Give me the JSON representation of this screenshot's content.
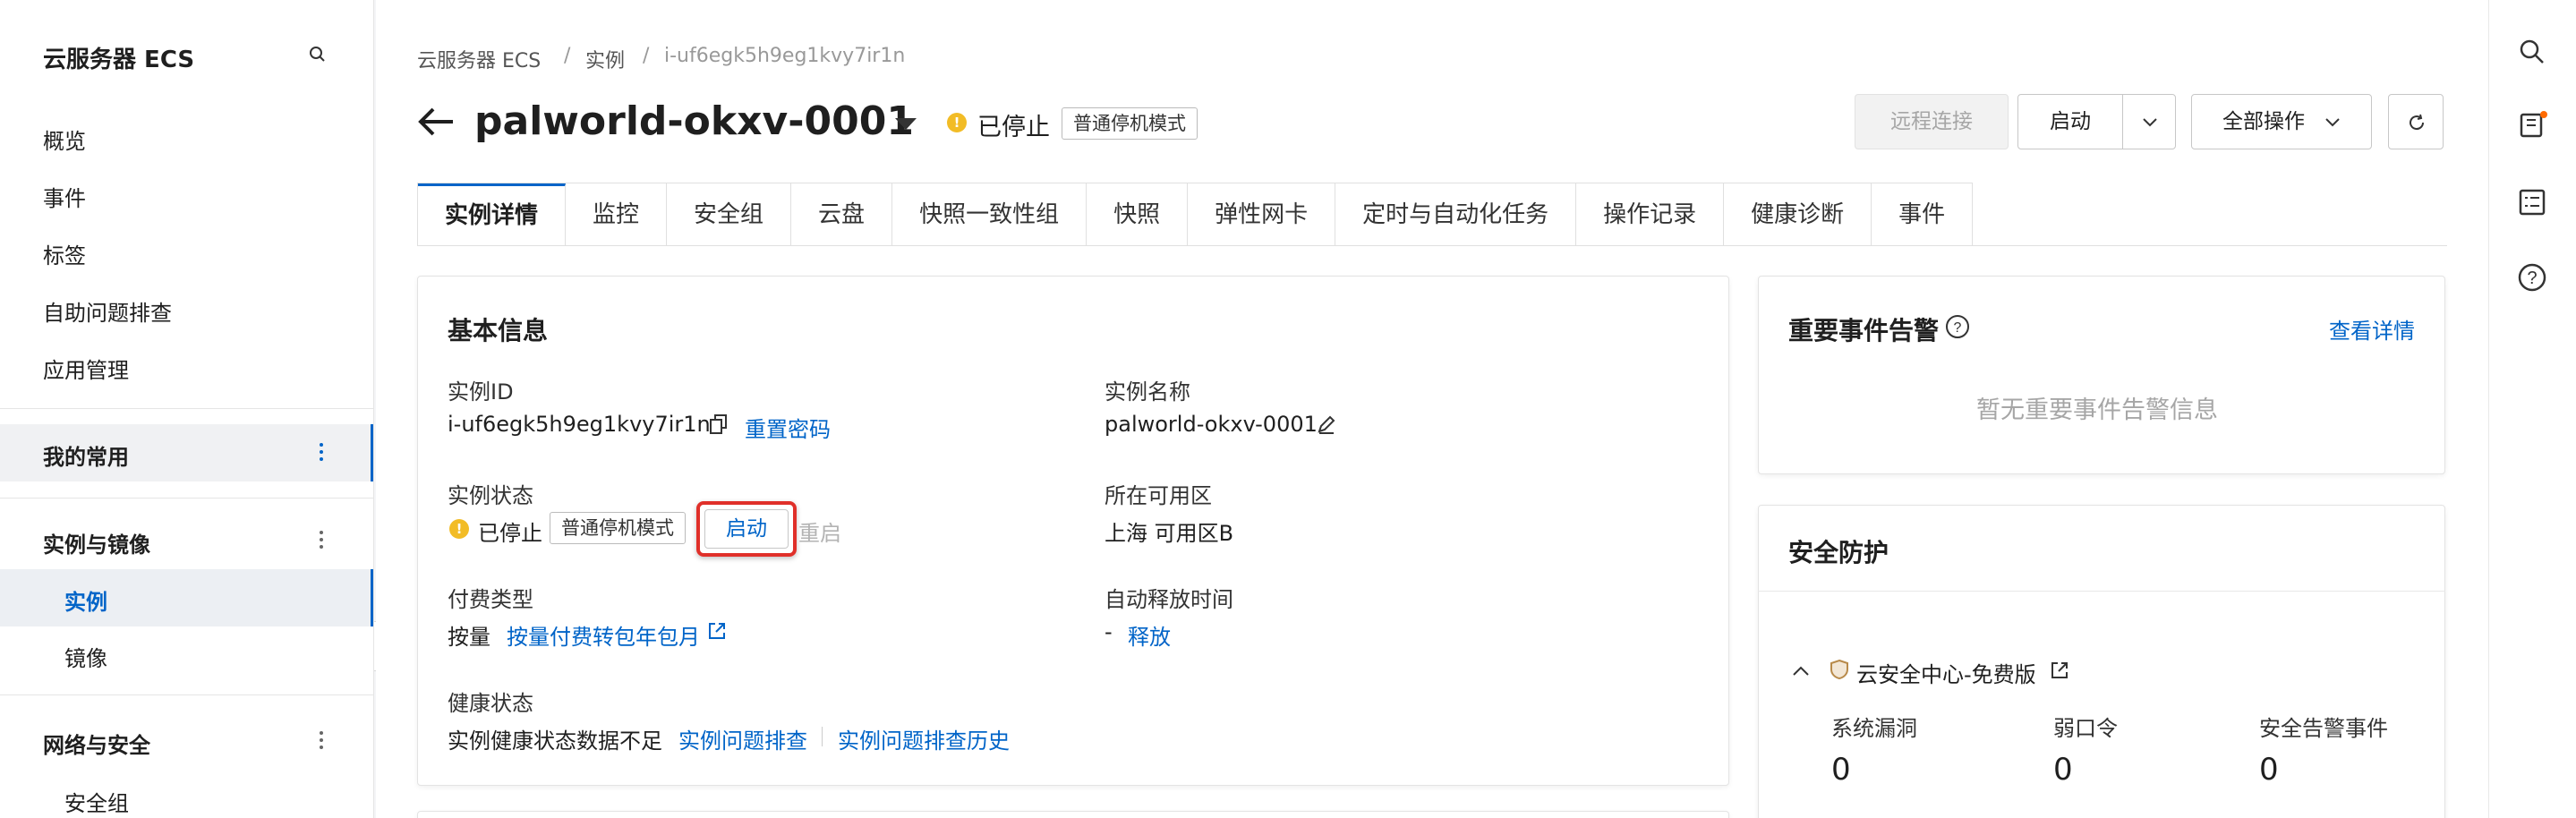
{
  "sidebar": {
    "title": "云服务器 ECS",
    "items": [
      "概览",
      "事件",
      "标签",
      "自助问题排查",
      "应用管理"
    ],
    "favorites": "我的常用",
    "group_instances": "实例与镜像",
    "sub_instances": "实例",
    "sub_images": "镜像",
    "group_network": "网络与安全",
    "sub_security_group": "安全组"
  },
  "breadcrumb": {
    "root": "云服务器 ECS",
    "level2": "实例",
    "current": "i-uf6egk5h9eg1kvy7ir1n",
    "sep": "/"
  },
  "header": {
    "title": "palworld-okxv-0001",
    "status": "已停止",
    "mode_badge": "普通停机模式",
    "btn_remote": "远程连接",
    "btn_start": "启动",
    "btn_all_ops": "全部操作"
  },
  "tabs": [
    "实例详情",
    "监控",
    "安全组",
    "云盘",
    "快照一致性组",
    "快照",
    "弹性网卡",
    "定时与自动化任务",
    "操作记录",
    "健康诊断",
    "事件"
  ],
  "basic": {
    "title": "基本信息",
    "instance_id_label": "实例ID",
    "instance_id": "i-uf6egk5h9eg1kvy7ir1n",
    "reset_password": "重置密码",
    "instance_name_label": "实例名称",
    "instance_name": "palworld-okxv-0001",
    "status_label": "实例状态",
    "status": "已停止",
    "mode_badge": "普通停机模式",
    "start_btn": "启动",
    "restart": "重启",
    "zone_label": "所在可用区",
    "zone": "上海 可用区B",
    "billing_label": "付费类型",
    "billing": "按量",
    "billing_convert": "按量付费转包年包月",
    "auto_release_label": "自动释放时间",
    "auto_release": "-",
    "release": "释放",
    "health_label": "健康状态",
    "health_text": "实例健康状态数据不足",
    "troubleshoot": "实例问题排查",
    "troubleshoot_history": "实例问题排查历史"
  },
  "alerts": {
    "title": "重要事件告警",
    "view_details": "查看详情",
    "empty": "暂无重要事件告警信息"
  },
  "security": {
    "title": "安全防护",
    "center": "云安全中心-免费版",
    "metrics": [
      {
        "label": "系统漏洞",
        "value": "0"
      },
      {
        "label": "弱口令",
        "value": "0"
      },
      {
        "label": "安全告警事件",
        "value": "0"
      }
    ]
  },
  "colors": {
    "accent": "#0064c8",
    "warning": "#f2bc26",
    "highlight_border": "#e0302a"
  }
}
